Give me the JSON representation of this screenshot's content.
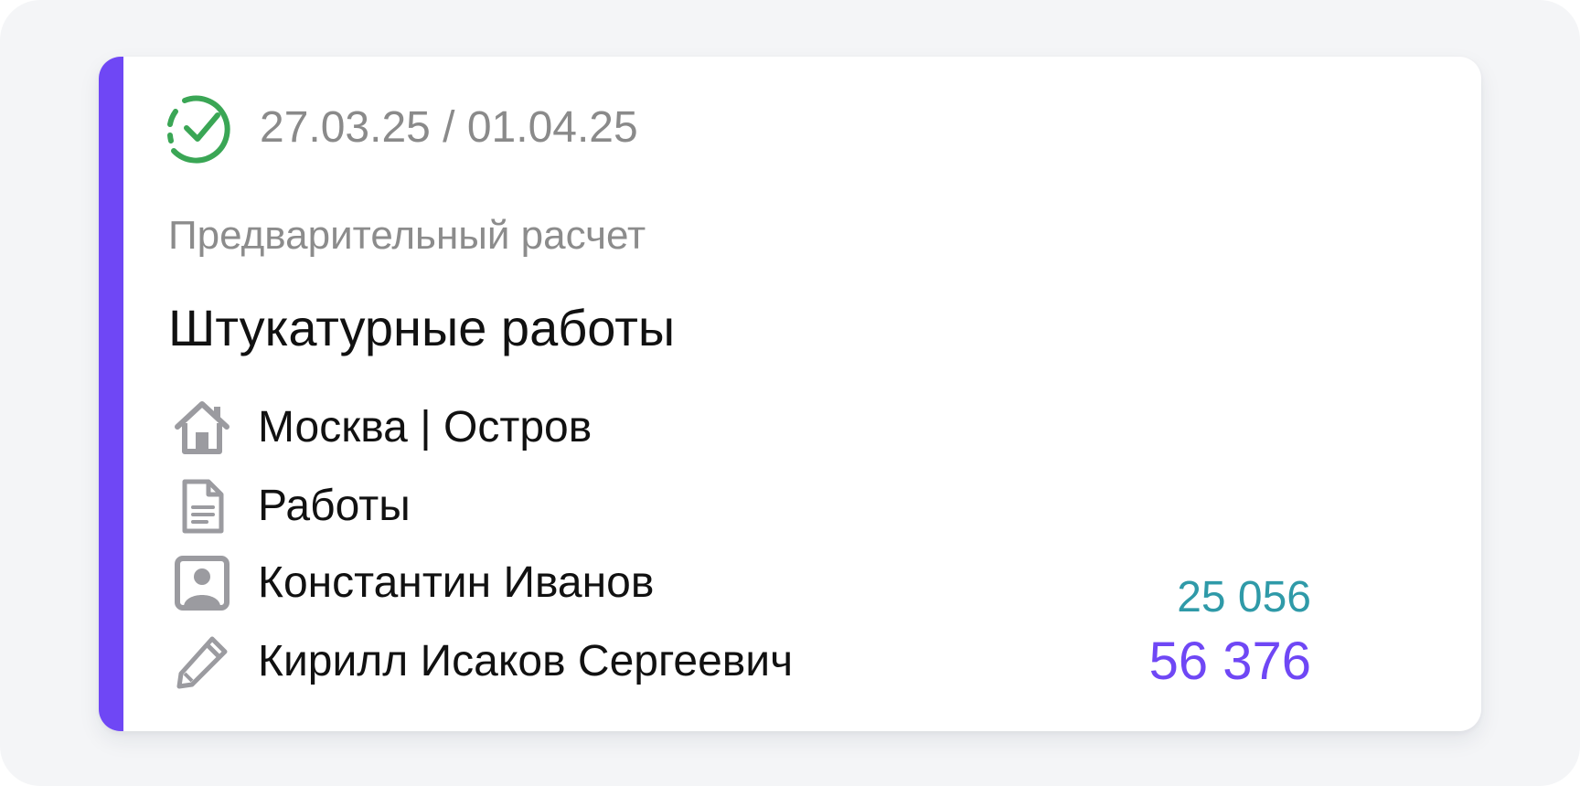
{
  "card": {
    "status_icon": "check-circle-icon",
    "dates": "27.03.25 / 01.04.25",
    "document_type": "Предварительный расчет",
    "title": "Штукатурные работы",
    "rows": [
      {
        "icon": "home-icon",
        "label": "Москва | Остров"
      },
      {
        "icon": "document-icon",
        "label": "Работы"
      },
      {
        "icon": "contact-card-icon",
        "label": "Константин Иванов"
      },
      {
        "icon": "pencil-icon",
        "label": "Кирилл Исаков Сергеевич"
      }
    ],
    "amount_secondary": "25 056",
    "amount_primary": "56 376"
  },
  "colors": {
    "accent": "#6f47f5",
    "status_green": "#3aa655",
    "amount_secondary": "#2f9aa8",
    "muted_text": "#8a8a8a",
    "icon_gray": "#9b9ba0"
  }
}
